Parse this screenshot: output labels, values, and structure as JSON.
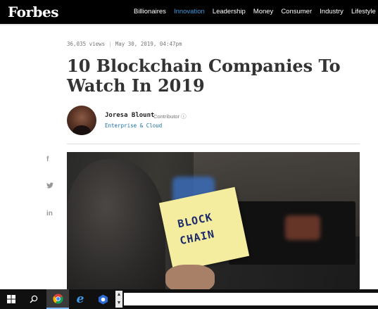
{
  "nav": {
    "logo": "Forbes",
    "links": [
      "Billionaires",
      "Innovation",
      "Leadership",
      "Money",
      "Consumer",
      "Industry",
      "Lifestyle"
    ]
  },
  "article": {
    "views": "36,035 views",
    "date": "May 30, 2019, 04:47pm",
    "title": "10 Blockchain Companies To Watch In 2019",
    "author": "Joresa Blount",
    "author_role": "Contributor ⓘ",
    "section": "Enterprise & Cloud",
    "image_note_line1": "BLOCK",
    "image_note_line2": "CHAIN"
  },
  "social": [
    "f",
    "𝕏",
    "in"
  ],
  "taskbar": {
    "icons": [
      "windows-start-icon",
      "search-icon",
      "chrome-icon",
      "edge-icon",
      "app-icon"
    ]
  },
  "colors": {
    "accent": "#3b9be0",
    "nav_bg": "#000000",
    "section_link": "#1a6fa8"
  }
}
